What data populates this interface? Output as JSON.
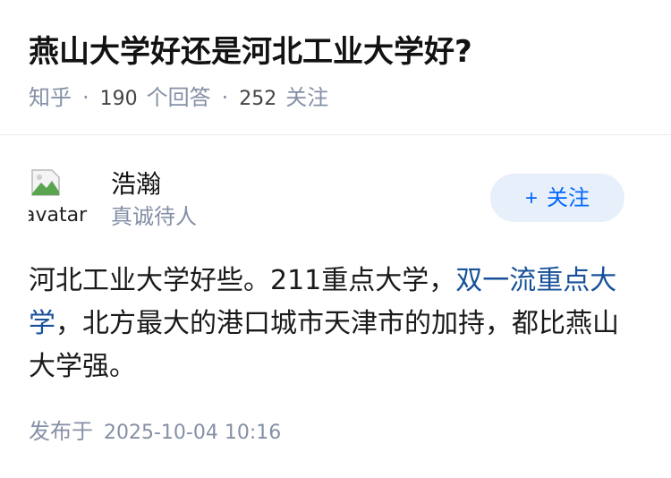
{
  "question": {
    "title": "燕山大学好还是河北工业大学好?",
    "source": "知乎",
    "answer_count": "190",
    "answer_label": "个回答",
    "follow_count": "252",
    "follow_label": "关注"
  },
  "author": {
    "avatar_alt": "avatar",
    "avatar_icon": "broken-image-icon",
    "name": "浩瀚",
    "bio": "真诚待人",
    "follow_button": "关注",
    "follow_icon": "plus-icon"
  },
  "answer": {
    "text_before": "河北工业大学好些。211重点大学，",
    "link_text": "双一流重点大学",
    "text_after": "，北方最大的港口城市天津市的加持，都比燕山大学强。"
  },
  "publish": {
    "label": "发布于",
    "datetime": "2025-10-04 10:16"
  },
  "colors": {
    "link": "#175199",
    "meta": "#8590a6",
    "follow_bg": "#e7f0fa",
    "follow_text": "#0066ff"
  }
}
